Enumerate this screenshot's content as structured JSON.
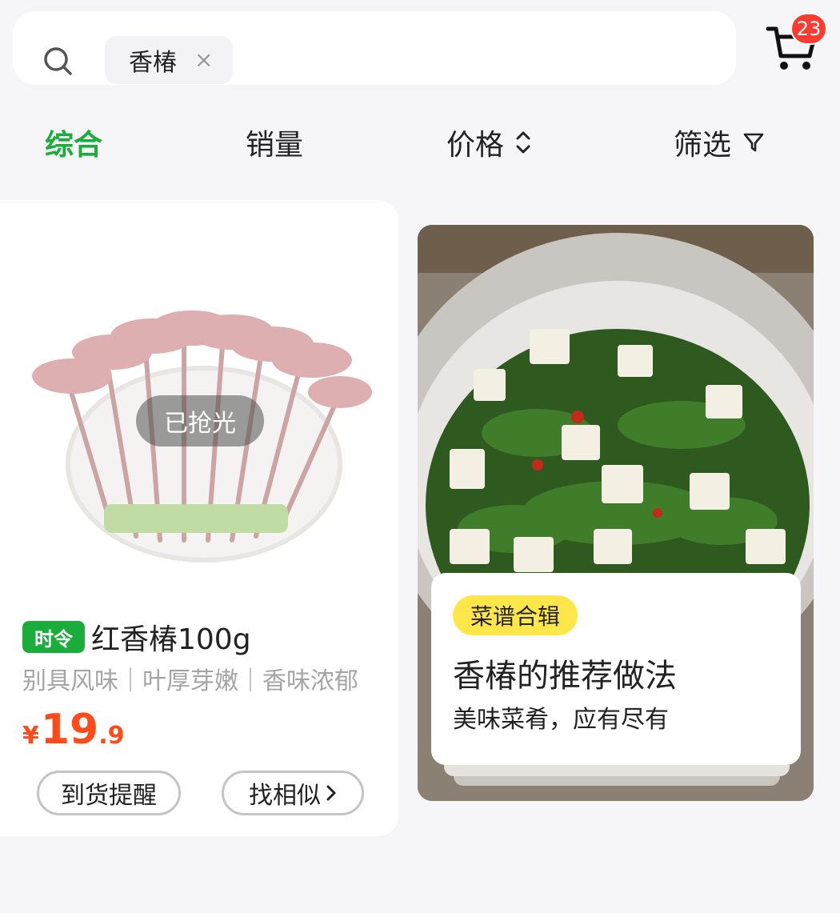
{
  "search": {
    "keyword": "香椿",
    "clear_icon": "×"
  },
  "cart": {
    "badge": "23"
  },
  "sort_tabs": [
    {
      "label": "综合",
      "active": true
    },
    {
      "label": "销量"
    },
    {
      "label": "价格",
      "icon": "sort-updown-icon"
    },
    {
      "label": "筛选",
      "icon": "filter-icon"
    }
  ],
  "product": {
    "status": "已抢光",
    "badge": "时令",
    "title": "红香椿100g",
    "subtitle": "别具风味｜叶厚芽嫩｜香味浓郁",
    "price": {
      "currency": "¥",
      "integer": "19",
      "decimal": ".9"
    },
    "buttons": {
      "notify": "到货提醒",
      "similar": "找相似"
    }
  },
  "recipe": {
    "tag": "菜谱合辑",
    "title": "香椿的推荐做法",
    "subtitle": "美味菜肴，应有尽有"
  },
  "colors": {
    "accent": "#1aad3b",
    "price": "#ff4a1a",
    "badge": "#ff3b30",
    "tag": "#ffe74a"
  }
}
